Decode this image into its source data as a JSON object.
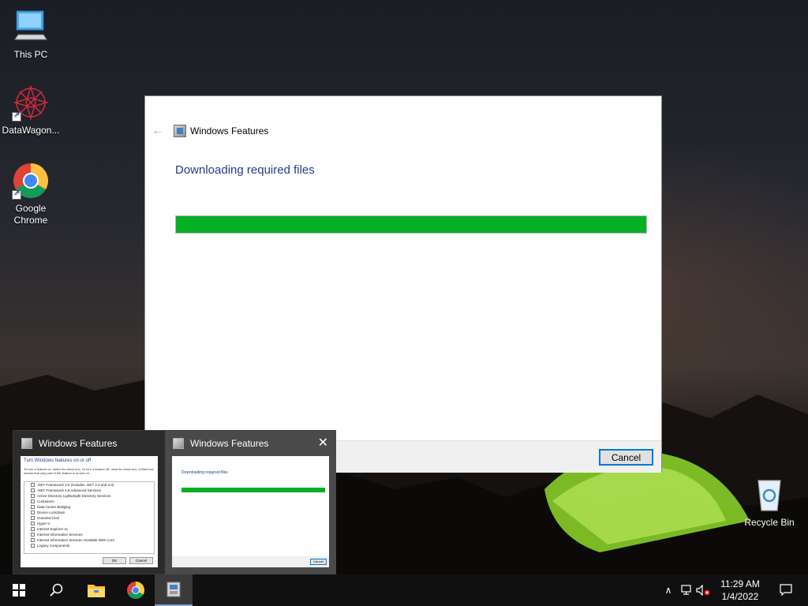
{
  "desktop": {
    "icons": [
      {
        "label": "This PC",
        "icon": "this-pc-icon"
      },
      {
        "label": "DataWagon...",
        "icon": "datawagon-icon"
      },
      {
        "label": "Google\nChrome",
        "icon": "chrome-icon"
      },
      {
        "label": "Recycle Bin",
        "icon": "recycle-bin-icon"
      }
    ]
  },
  "dialog": {
    "title": "Windows Features",
    "heading": "Downloading required files",
    "progress_percent": 100,
    "cancel_label": "Cancel",
    "progress_color": "#06b025"
  },
  "thumbnails": [
    {
      "title": "Windows Features",
      "heading": "Turn Windows features on or off",
      "description": "To turn a feature on, select its check box. To turn a feature off, clear its check box. A filled box means that only part of the feature is turned on.",
      "features": [
        ".NET Framework 3.5 (includes .NET 2.0 and 3.0)",
        ".NET Framework 4.8 Advanced Services",
        "Active Directory Lightweight Directory Services",
        "Containers",
        "Data Center Bridging",
        "Device Lockdown",
        "Guarded Host",
        "Hyper-V",
        "Internet Explorer 11",
        "Internet Information Services",
        "Internet Information Services Hostable Web Core",
        "Legacy Components"
      ],
      "ok_label": "OK",
      "cancel_label": "Cancel"
    },
    {
      "title": "Windows Features",
      "heading": "Downloading required files",
      "cancel_label": "Cancel",
      "close_label": "✕"
    }
  ],
  "taskbar": {
    "items": [
      "start-icon",
      "search-icon",
      "file-explorer-icon",
      "chrome-icon",
      "windows-features-icon"
    ],
    "time": "11:29 AM",
    "date": "1/4/2022"
  }
}
